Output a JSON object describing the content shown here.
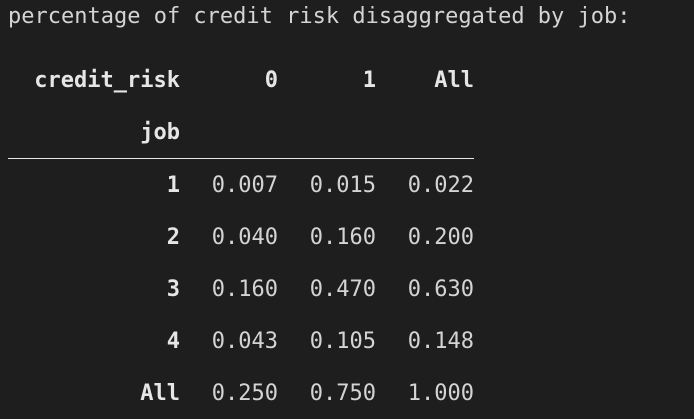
{
  "title": "percentage of credit risk disaggregated by job:",
  "table": {
    "columns_name": "credit_risk",
    "columns": [
      "0",
      "1",
      "All"
    ],
    "index_name": "job",
    "rows": [
      {
        "label": "1",
        "values": [
          "0.007",
          "0.015",
          "0.022"
        ]
      },
      {
        "label": "2",
        "values": [
          "0.040",
          "0.160",
          "0.200"
        ]
      },
      {
        "label": "3",
        "values": [
          "0.160",
          "0.470",
          "0.630"
        ]
      },
      {
        "label": "4",
        "values": [
          "0.043",
          "0.105",
          "0.148"
        ]
      },
      {
        "label": "All",
        "values": [
          "0.250",
          "0.750",
          "1.000"
        ]
      }
    ]
  },
  "colors": {
    "background": "#1e1e1e",
    "text": "#d4d4d4",
    "header_text": "#e6e6e6"
  }
}
